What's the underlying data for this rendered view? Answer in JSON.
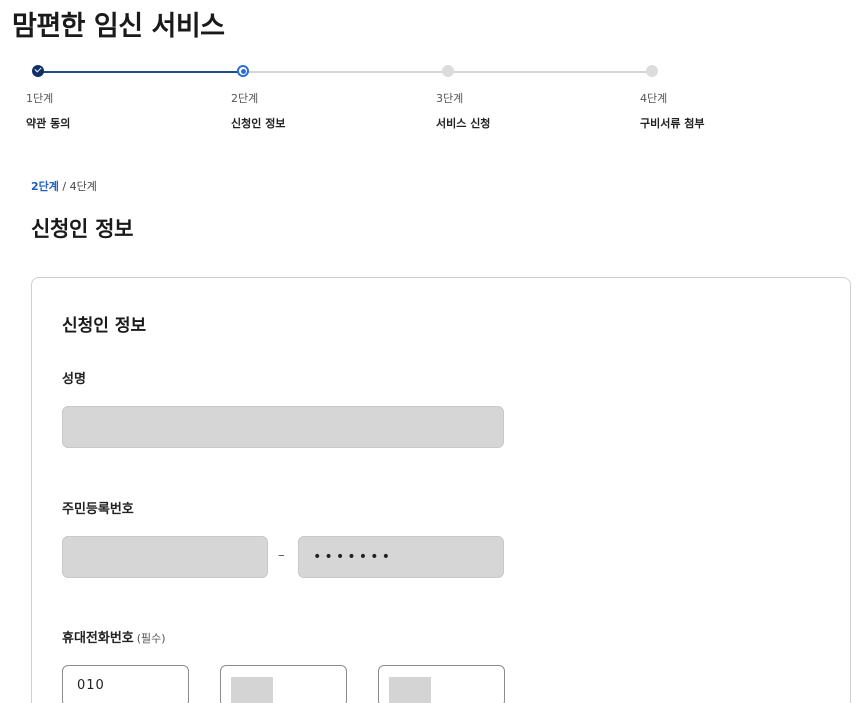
{
  "page": {
    "title": "맘편한 임신 서비스"
  },
  "steps": [
    {
      "num": "1단계",
      "name": "약관 동의",
      "state": "done"
    },
    {
      "num": "2단계",
      "name": "신청인 정보",
      "state": "current"
    },
    {
      "num": "3단계",
      "name": "서비스 신청",
      "state": "todo"
    },
    {
      "num": "4단계",
      "name": "구비서류 첨부",
      "state": "todo"
    }
  ],
  "progress": {
    "current": "2단계",
    "separator": "/",
    "total": "4단계"
  },
  "section": {
    "heading": "신청인 정보"
  },
  "form": {
    "card_title": "신청인 정보",
    "name": {
      "label": "성명",
      "value": ""
    },
    "rrn": {
      "label": "주민등록번호",
      "front_value": "",
      "dash": "–",
      "back_value": "•••••••"
    },
    "phone": {
      "label": "휴대전화번호",
      "optional": "(필수)",
      "part1": "010",
      "part2": "",
      "part3": ""
    }
  },
  "colors": {
    "accent": "#1f5fc0",
    "done": "#0f2f66",
    "input_disabled": "#d6d6d6"
  }
}
